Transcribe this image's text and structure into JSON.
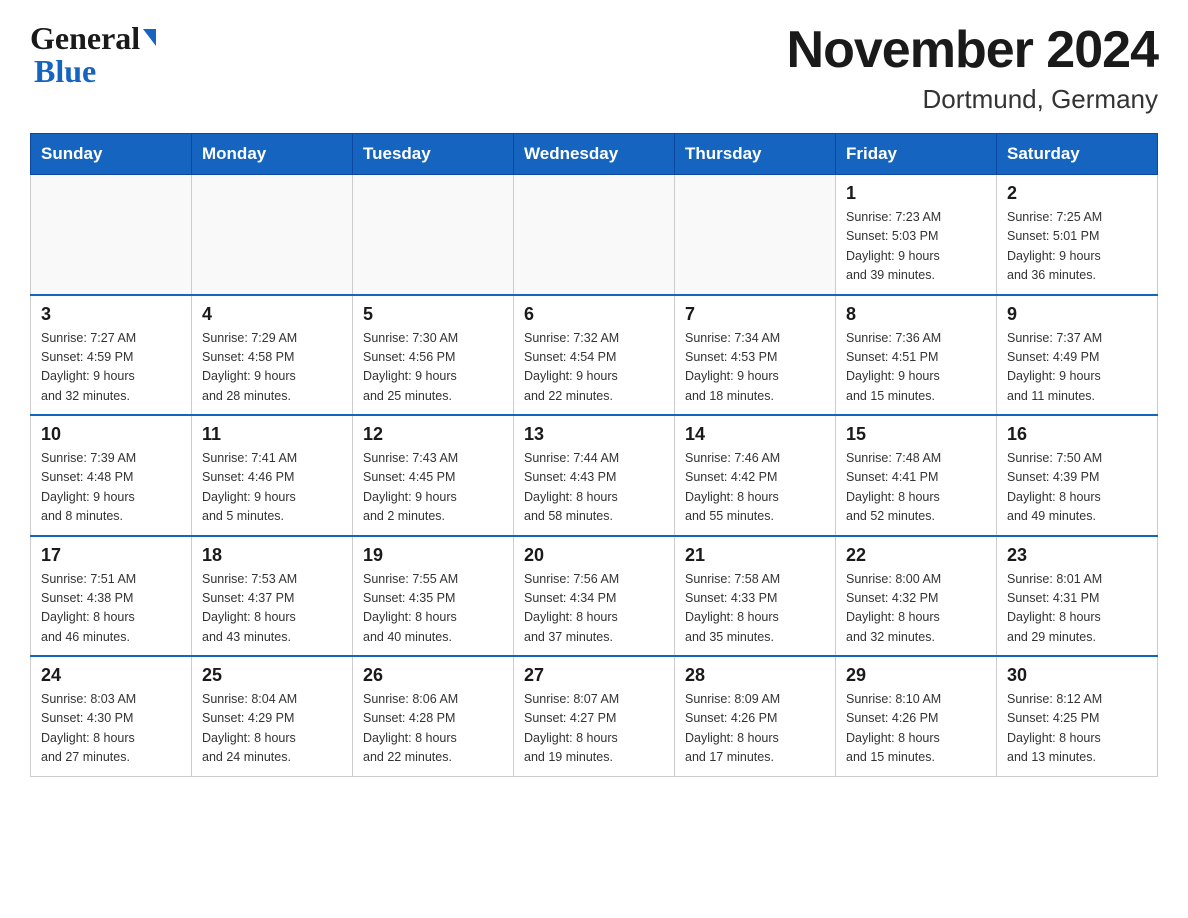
{
  "logo": {
    "line1": "General",
    "line2": "Blue"
  },
  "title": "November 2024",
  "subtitle": "Dortmund, Germany",
  "days": [
    "Sunday",
    "Monday",
    "Tuesday",
    "Wednesday",
    "Thursday",
    "Friday",
    "Saturday"
  ],
  "weeks": [
    [
      {
        "day": "",
        "info": ""
      },
      {
        "day": "",
        "info": ""
      },
      {
        "day": "",
        "info": ""
      },
      {
        "day": "",
        "info": ""
      },
      {
        "day": "",
        "info": ""
      },
      {
        "day": "1",
        "info": "Sunrise: 7:23 AM\nSunset: 5:03 PM\nDaylight: 9 hours\nand 39 minutes."
      },
      {
        "day": "2",
        "info": "Sunrise: 7:25 AM\nSunset: 5:01 PM\nDaylight: 9 hours\nand 36 minutes."
      }
    ],
    [
      {
        "day": "3",
        "info": "Sunrise: 7:27 AM\nSunset: 4:59 PM\nDaylight: 9 hours\nand 32 minutes."
      },
      {
        "day": "4",
        "info": "Sunrise: 7:29 AM\nSunset: 4:58 PM\nDaylight: 9 hours\nand 28 minutes."
      },
      {
        "day": "5",
        "info": "Sunrise: 7:30 AM\nSunset: 4:56 PM\nDaylight: 9 hours\nand 25 minutes."
      },
      {
        "day": "6",
        "info": "Sunrise: 7:32 AM\nSunset: 4:54 PM\nDaylight: 9 hours\nand 22 minutes."
      },
      {
        "day": "7",
        "info": "Sunrise: 7:34 AM\nSunset: 4:53 PM\nDaylight: 9 hours\nand 18 minutes."
      },
      {
        "day": "8",
        "info": "Sunrise: 7:36 AM\nSunset: 4:51 PM\nDaylight: 9 hours\nand 15 minutes."
      },
      {
        "day": "9",
        "info": "Sunrise: 7:37 AM\nSunset: 4:49 PM\nDaylight: 9 hours\nand 11 minutes."
      }
    ],
    [
      {
        "day": "10",
        "info": "Sunrise: 7:39 AM\nSunset: 4:48 PM\nDaylight: 9 hours\nand 8 minutes."
      },
      {
        "day": "11",
        "info": "Sunrise: 7:41 AM\nSunset: 4:46 PM\nDaylight: 9 hours\nand 5 minutes."
      },
      {
        "day": "12",
        "info": "Sunrise: 7:43 AM\nSunset: 4:45 PM\nDaylight: 9 hours\nand 2 minutes."
      },
      {
        "day": "13",
        "info": "Sunrise: 7:44 AM\nSunset: 4:43 PM\nDaylight: 8 hours\nand 58 minutes."
      },
      {
        "day": "14",
        "info": "Sunrise: 7:46 AM\nSunset: 4:42 PM\nDaylight: 8 hours\nand 55 minutes."
      },
      {
        "day": "15",
        "info": "Sunrise: 7:48 AM\nSunset: 4:41 PM\nDaylight: 8 hours\nand 52 minutes."
      },
      {
        "day": "16",
        "info": "Sunrise: 7:50 AM\nSunset: 4:39 PM\nDaylight: 8 hours\nand 49 minutes."
      }
    ],
    [
      {
        "day": "17",
        "info": "Sunrise: 7:51 AM\nSunset: 4:38 PM\nDaylight: 8 hours\nand 46 minutes."
      },
      {
        "day": "18",
        "info": "Sunrise: 7:53 AM\nSunset: 4:37 PM\nDaylight: 8 hours\nand 43 minutes."
      },
      {
        "day": "19",
        "info": "Sunrise: 7:55 AM\nSunset: 4:35 PM\nDaylight: 8 hours\nand 40 minutes."
      },
      {
        "day": "20",
        "info": "Sunrise: 7:56 AM\nSunset: 4:34 PM\nDaylight: 8 hours\nand 37 minutes."
      },
      {
        "day": "21",
        "info": "Sunrise: 7:58 AM\nSunset: 4:33 PM\nDaylight: 8 hours\nand 35 minutes."
      },
      {
        "day": "22",
        "info": "Sunrise: 8:00 AM\nSunset: 4:32 PM\nDaylight: 8 hours\nand 32 minutes."
      },
      {
        "day": "23",
        "info": "Sunrise: 8:01 AM\nSunset: 4:31 PM\nDaylight: 8 hours\nand 29 minutes."
      }
    ],
    [
      {
        "day": "24",
        "info": "Sunrise: 8:03 AM\nSunset: 4:30 PM\nDaylight: 8 hours\nand 27 minutes."
      },
      {
        "day": "25",
        "info": "Sunrise: 8:04 AM\nSunset: 4:29 PM\nDaylight: 8 hours\nand 24 minutes."
      },
      {
        "day": "26",
        "info": "Sunrise: 8:06 AM\nSunset: 4:28 PM\nDaylight: 8 hours\nand 22 minutes."
      },
      {
        "day": "27",
        "info": "Sunrise: 8:07 AM\nSunset: 4:27 PM\nDaylight: 8 hours\nand 19 minutes."
      },
      {
        "day": "28",
        "info": "Sunrise: 8:09 AM\nSunset: 4:26 PM\nDaylight: 8 hours\nand 17 minutes."
      },
      {
        "day": "29",
        "info": "Sunrise: 8:10 AM\nSunset: 4:26 PM\nDaylight: 8 hours\nand 15 minutes."
      },
      {
        "day": "30",
        "info": "Sunrise: 8:12 AM\nSunset: 4:25 PM\nDaylight: 8 hours\nand 13 minutes."
      }
    ]
  ]
}
